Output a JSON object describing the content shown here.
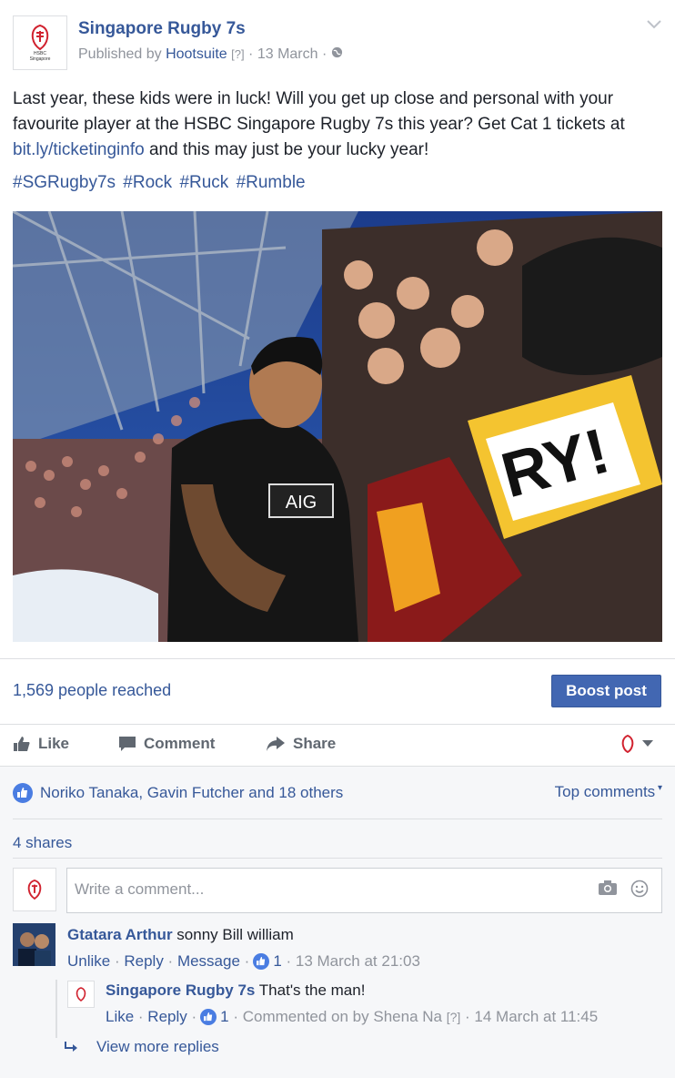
{
  "post": {
    "page_name": "Singapore Rugby 7s",
    "published_by_prefix": "Published by",
    "publisher": "Hootsuite",
    "help_marker": "[?]",
    "date": "13 March",
    "sep": "·",
    "logo_text_line1": "HSBC",
    "logo_text_line2": "Singapore",
    "body_part1": "Last year, these kids were in luck! Will you get up close and personal with your favourite player at the HSBC Singapore Rugby 7s this year? Get Cat 1 tickets at ",
    "body_link": "bit.ly/ticketinginfo",
    "body_part2": " and this may just be your lucky year!",
    "hashtags": [
      "#SGRugby7s",
      "#Rock",
      "#Ruck",
      "#Rumble"
    ],
    "photo_sign_text": "RY!",
    "photo_jersey_text": "AIG",
    "colors": {
      "accent": "#365899",
      "boost": "#4267b2",
      "like": "#4a7de2"
    }
  },
  "insights": {
    "reach": "1,569 people reached",
    "boost_label": "Boost post"
  },
  "actions": {
    "like": "Like",
    "comment": "Comment",
    "share": "Share"
  },
  "reactions": {
    "likes_text": "Noriko Tanaka, Gavin Futcher and 18 others",
    "top_comments": "Top comments",
    "shares": "4 shares"
  },
  "composer": {
    "placeholder": "Write a comment..."
  },
  "comments": [
    {
      "author": "Gtatara Arthur",
      "text": "sonny Bill william",
      "unlike": "Unlike",
      "reply": "Reply",
      "message": "Message",
      "likes": "1",
      "time": "13 March at 21:03",
      "replies": [
        {
          "author": "Singapore Rugby 7s",
          "text": "That's the man!",
          "like": "Like",
          "reply": "Reply",
          "likes": "1",
          "commented_on": "Commented on by Shena Na",
          "help_marker": "[?]",
          "time": "14 March at 11:45"
        }
      ],
      "view_more": "View more replies"
    }
  ]
}
